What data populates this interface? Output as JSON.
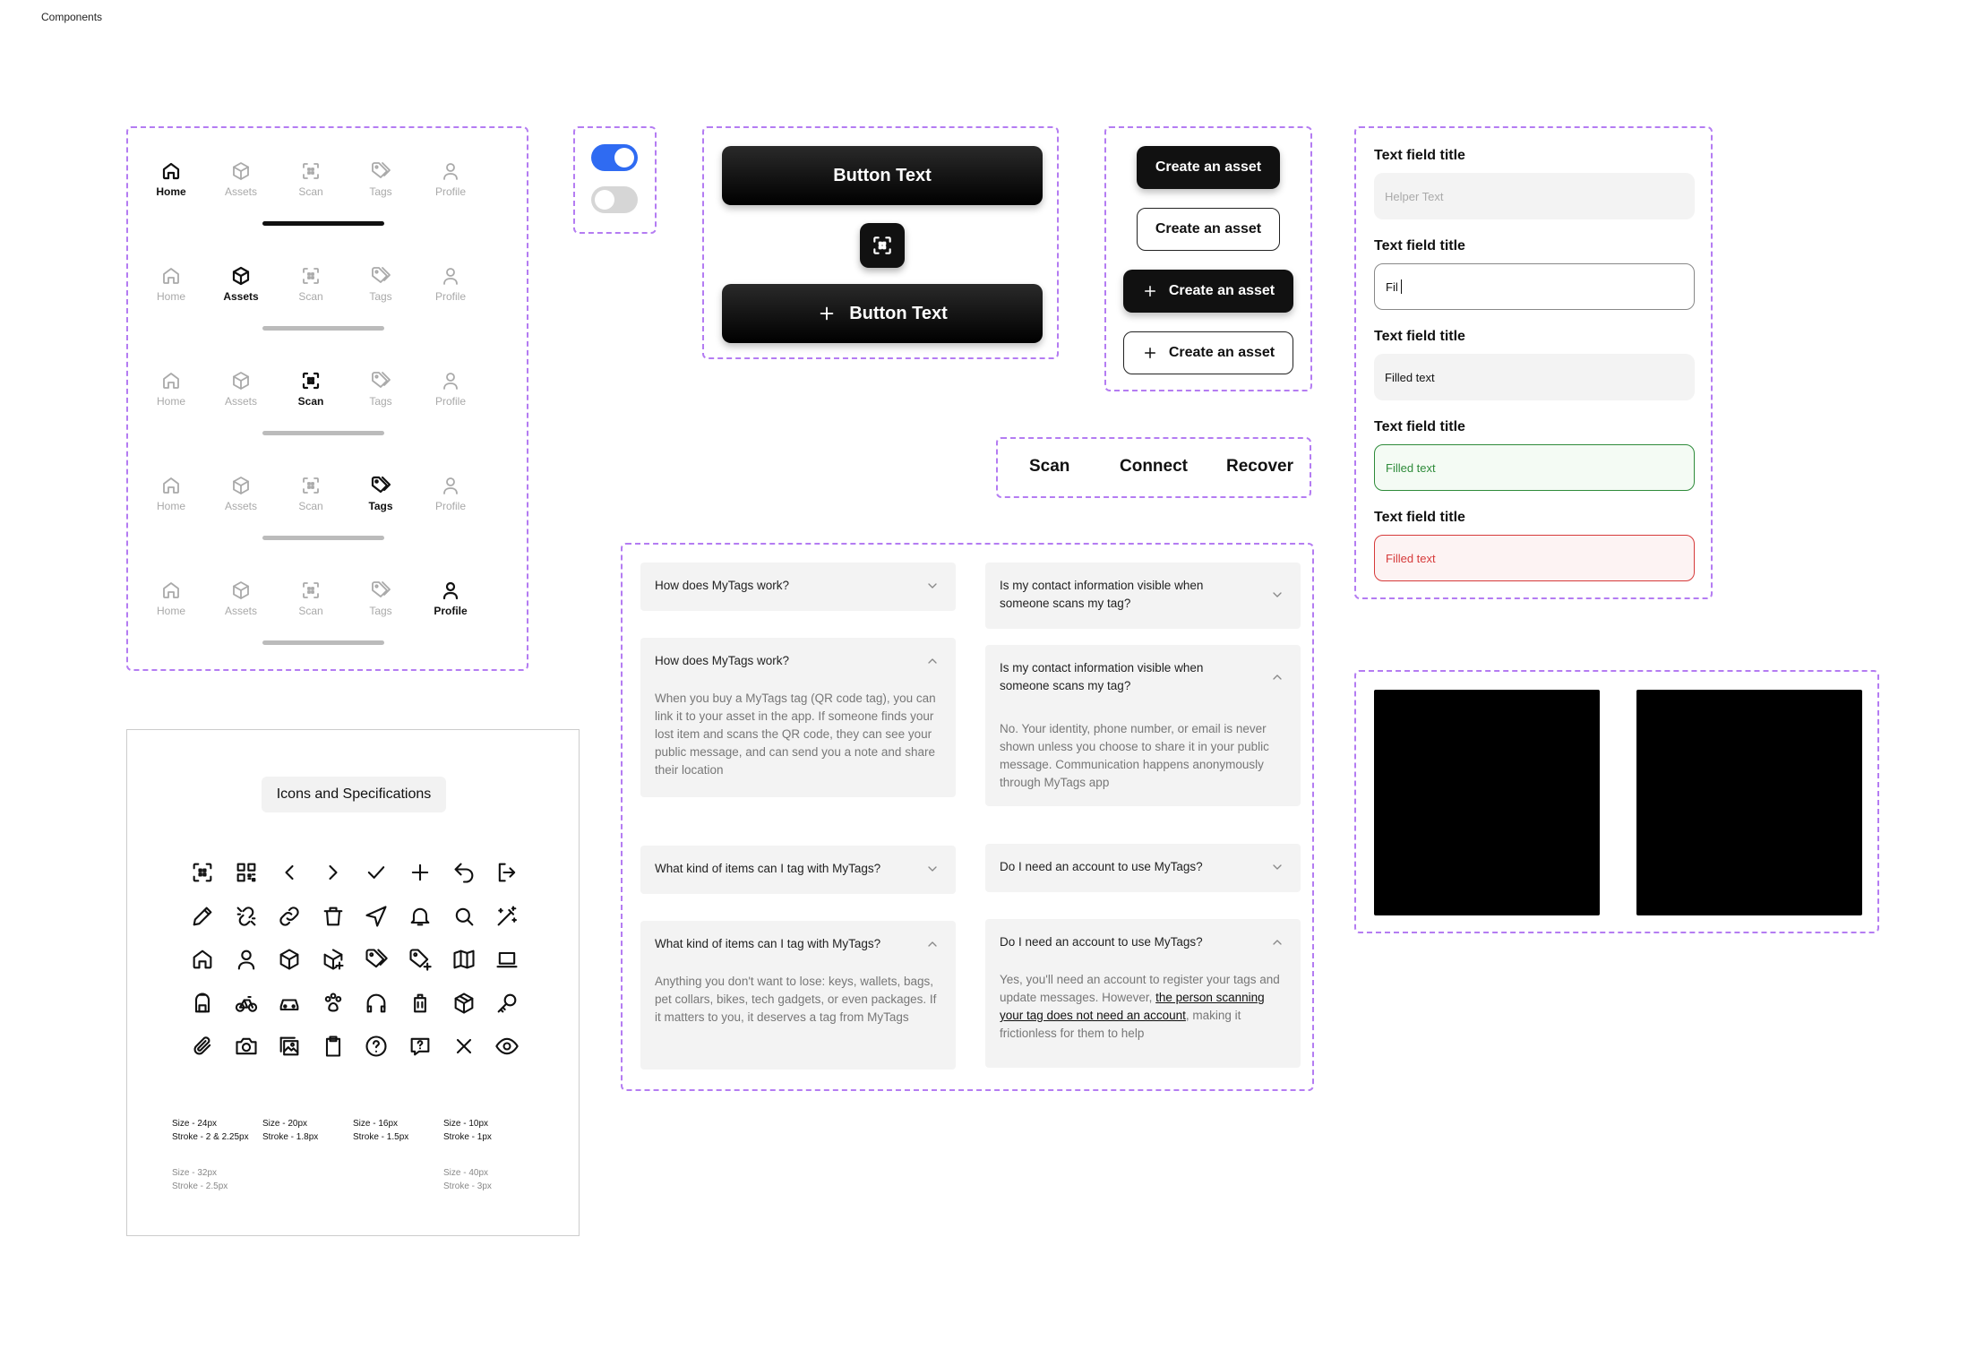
{
  "page": {
    "label": "Components"
  },
  "nav": {
    "items": [
      "Home",
      "Assets",
      "Scan",
      "Tags",
      "Profile"
    ],
    "rows": [
      0,
      1,
      2,
      3,
      4
    ]
  },
  "buttons": {
    "primary_label": "Button Text",
    "primary_icon_label": "Button Text",
    "cta_labels": [
      "Create an asset",
      "Create an asset",
      "Create an asset",
      "Create an asset"
    ]
  },
  "segmented": {
    "items": [
      "Scan",
      "Connect",
      "Recover"
    ]
  },
  "text_fields": [
    {
      "title": "Text field title",
      "value": "Helper Text",
      "state": "placeholder"
    },
    {
      "title": "Text field title",
      "value": "Fil",
      "state": "focused"
    },
    {
      "title": "Text field title",
      "value": "Filled text",
      "state": "filled"
    },
    {
      "title": "Text field title",
      "value": "Filled text",
      "state": "success"
    },
    {
      "title": "Text field title",
      "value": "Filled text",
      "state": "error"
    }
  ],
  "faq": {
    "q1": "How does MyTags work?",
    "a1": "When you buy a MyTags tag (QR code tag), you can link it to your asset in the app. If someone finds your lost item and scans the QR code, they can see your public message, and can send you a note and share their location",
    "q2": "Is my contact information visible when someone scans my tag?",
    "a2": "No. Your identity, phone number, or email is never shown unless you choose to share it in your public message. Communication happens anonymously through MyTags app",
    "q3": "What kind of items can I tag with MyTags?",
    "a3": "Anything you don't want to lose: keys, wallets, bags, pet collars, bikes, tech gadgets, or even packages. If it matters to you, it deserves a tag from MyTags",
    "q4": "Do I need an account to use MyTags?",
    "a4_pre": "Yes, you'll need an account to register your tags and update messages. However, ",
    "a4_link": "the person scanning your tag does not need an account",
    "a4_post": ", making it frictionless for them to help"
  },
  "icons_card": {
    "title": "Icons and Specifications",
    "icons": [
      "scan-icon",
      "qr-code-icon",
      "chevron-left-icon",
      "chevron-right-icon",
      "check-icon",
      "plus-icon",
      "undo-icon",
      "logout-icon",
      "pencil-icon",
      "unlink-icon",
      "link-icon",
      "trash-icon",
      "navigation-icon",
      "bell-icon",
      "search-icon",
      "magic-wand-icon",
      "home-icon",
      "user-icon",
      "box-icon",
      "box-add-icon",
      "tag-icon",
      "tag-add-icon",
      "map-icon",
      "laptop-icon",
      "backpack-icon",
      "bicycle-icon",
      "car-icon",
      "pet-paw-icon",
      "headphones-icon",
      "luggage-icon",
      "package-icon",
      "key-icon",
      "paperclip-icon",
      "camera-icon",
      "image-icon",
      "clipboard-icon",
      "help-circle-icon",
      "message-question-icon",
      "close-icon",
      "eye-icon"
    ],
    "specs": [
      {
        "size": "Size - 24px",
        "stroke": "Stroke - 2 & 2.25px"
      },
      {
        "size": "Size - 20px",
        "stroke": "Stroke - 1.8px"
      },
      {
        "size": "Size - 16px",
        "stroke": "Stroke - 1.5px"
      },
      {
        "size": "Size - 10px",
        "stroke": "Stroke - 1px"
      },
      {
        "size": "Size - 32px",
        "stroke": "Stroke - 2.5px"
      },
      {
        "size": "Size - 40px",
        "stroke": "Stroke - 3px"
      }
    ]
  },
  "colors": {
    "accent": "#2f6bf2",
    "dash": "#b47cf2",
    "success": "#2e8b3a",
    "error": "#d63a3a"
  }
}
